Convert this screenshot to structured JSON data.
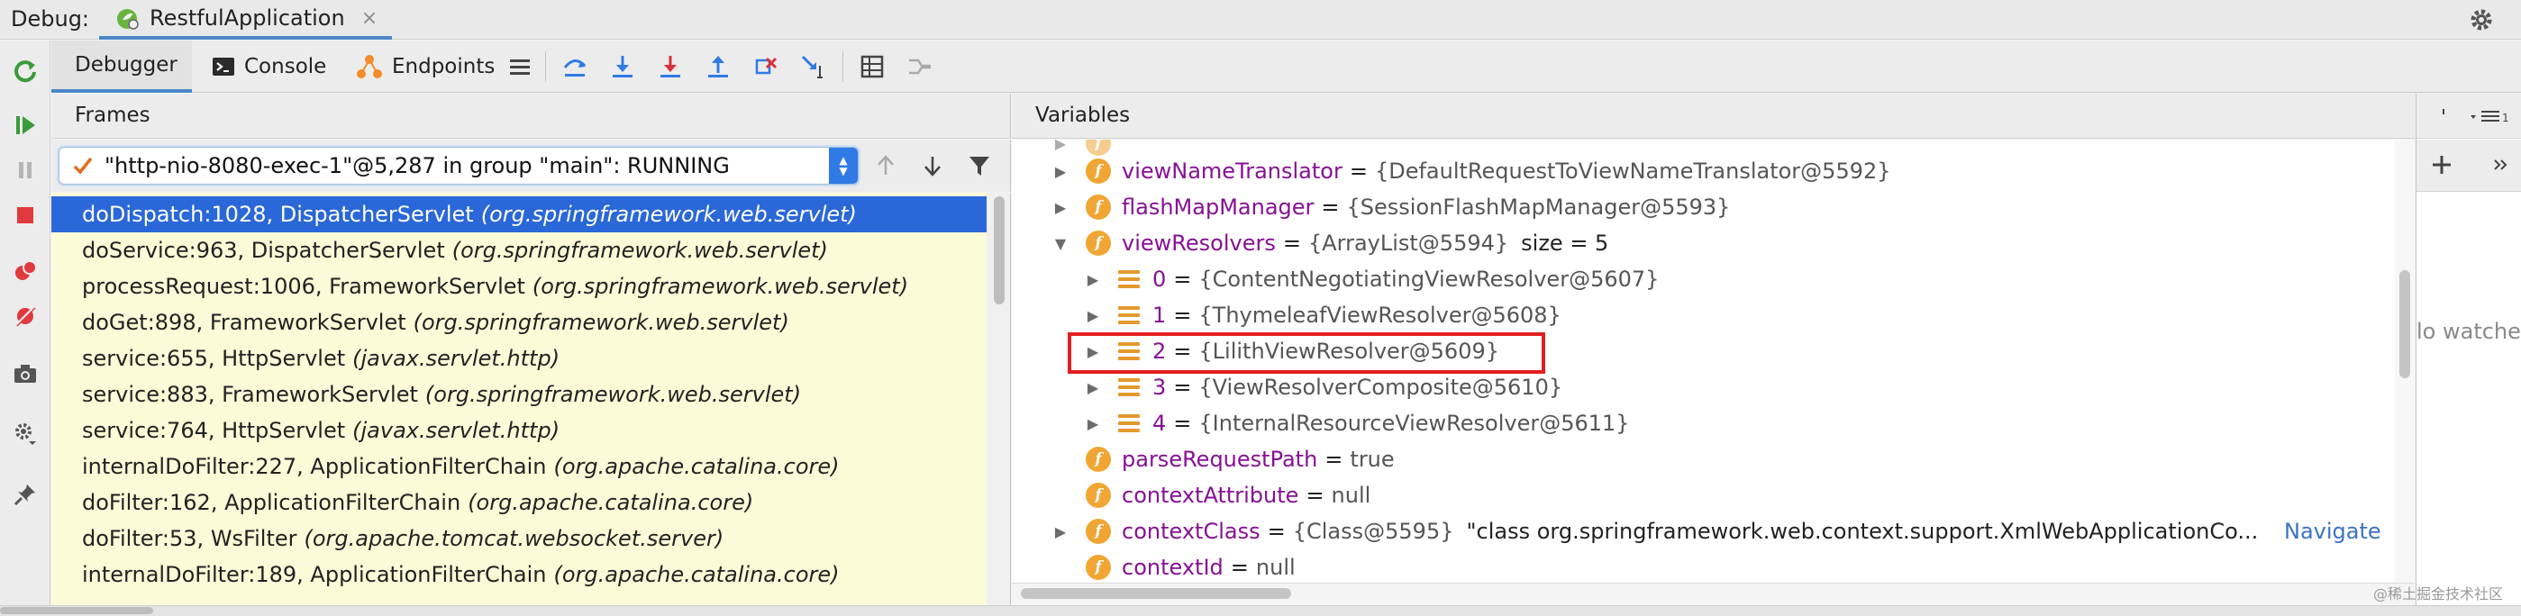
{
  "title_bar": {
    "debug_label": "Debug:",
    "run_tab": "RestfulApplication",
    "close_glyph": "×"
  },
  "toolbar": {
    "tabs": [
      {
        "label": "Debugger",
        "icon": "none"
      },
      {
        "label": "Console",
        "icon": "console-icon"
      },
      {
        "label": "Endpoints",
        "icon": "endpoints-icon"
      }
    ]
  },
  "frames": {
    "header": "Frames",
    "thread_selector": "\"http-nio-8080-exec-1\"@5,287 in group \"main\": RUNNING",
    "items": [
      {
        "method": "doDispatch:1028, DispatcherServlet",
        "package": "(org.springframework.web.servlet)"
      },
      {
        "method": "doService:963, DispatcherServlet",
        "package": "(org.springframework.web.servlet)"
      },
      {
        "method": "processRequest:1006, FrameworkServlet",
        "package": "(org.springframework.web.servlet)"
      },
      {
        "method": "doGet:898, FrameworkServlet",
        "package": "(org.springframework.web.servlet)"
      },
      {
        "method": "service:655, HttpServlet",
        "package": "(javax.servlet.http)"
      },
      {
        "method": "service:883, FrameworkServlet",
        "package": "(org.springframework.web.servlet)"
      },
      {
        "method": "service:764, HttpServlet",
        "package": "(javax.servlet.http)"
      },
      {
        "method": "internalDoFilter:227, ApplicationFilterChain",
        "package": "(org.apache.catalina.core)"
      },
      {
        "method": "doFilter:162, ApplicationFilterChain",
        "package": "(org.apache.catalina.core)"
      },
      {
        "method": "doFilter:53, WsFilter",
        "package": "(org.apache.tomcat.websocket.server)"
      },
      {
        "method": "internalDoFilter:189, ApplicationFilterChain",
        "package": "(org.apache.catalina.core)"
      }
    ]
  },
  "variables": {
    "header": "Variables",
    "items": [
      {
        "name": "viewNameTranslator",
        "value": "{DefaultRequestToViewNameTranslator@5592}",
        "extra": "",
        "nav": ""
      },
      {
        "name": "flashMapManager",
        "value": "{SessionFlashMapManager@5593}",
        "extra": "",
        "nav": ""
      },
      {
        "name": "viewResolvers",
        "value": "{ArrayList@5594}",
        "extra": "size = 5",
        "nav": ""
      },
      {
        "name": "0",
        "value": "{ContentNegotiatingViewResolver@5607}",
        "extra": "",
        "nav": ""
      },
      {
        "name": "1",
        "value": "{ThymeleafViewResolver@5608}",
        "extra": "",
        "nav": ""
      },
      {
        "name": "2",
        "value": "{LilithViewResolver@5609}",
        "extra": "",
        "nav": ""
      },
      {
        "name": "3",
        "value": "{ViewResolverComposite@5610}",
        "extra": "",
        "nav": ""
      },
      {
        "name": "4",
        "value": "{InternalResourceViewResolver@5611}",
        "extra": "",
        "nav": ""
      },
      {
        "name": "parseRequestPath",
        "value": "true",
        "extra": "",
        "nav": ""
      },
      {
        "name": "contextAttribute",
        "value": "null",
        "extra": "",
        "nav": ""
      },
      {
        "name": "contextClass",
        "value": "{Class@5595}",
        "extra": "\"class org.springframework.web.context.support.XmlWebApplicationCo...",
        "nav": "Navigate"
      },
      {
        "name": "contextId",
        "value": "null",
        "extra": "",
        "nav": ""
      }
    ]
  },
  "watches": {
    "empty_text": "lo watche"
  },
  "watermark": "@稀土掘金技术社区",
  "colors": {
    "selection": "#2a67d8",
    "frames_bg": "#fbfbd8",
    "field_icon": "#f1a533",
    "highlight": "#e21f1f",
    "accent": "#4a88c7"
  }
}
